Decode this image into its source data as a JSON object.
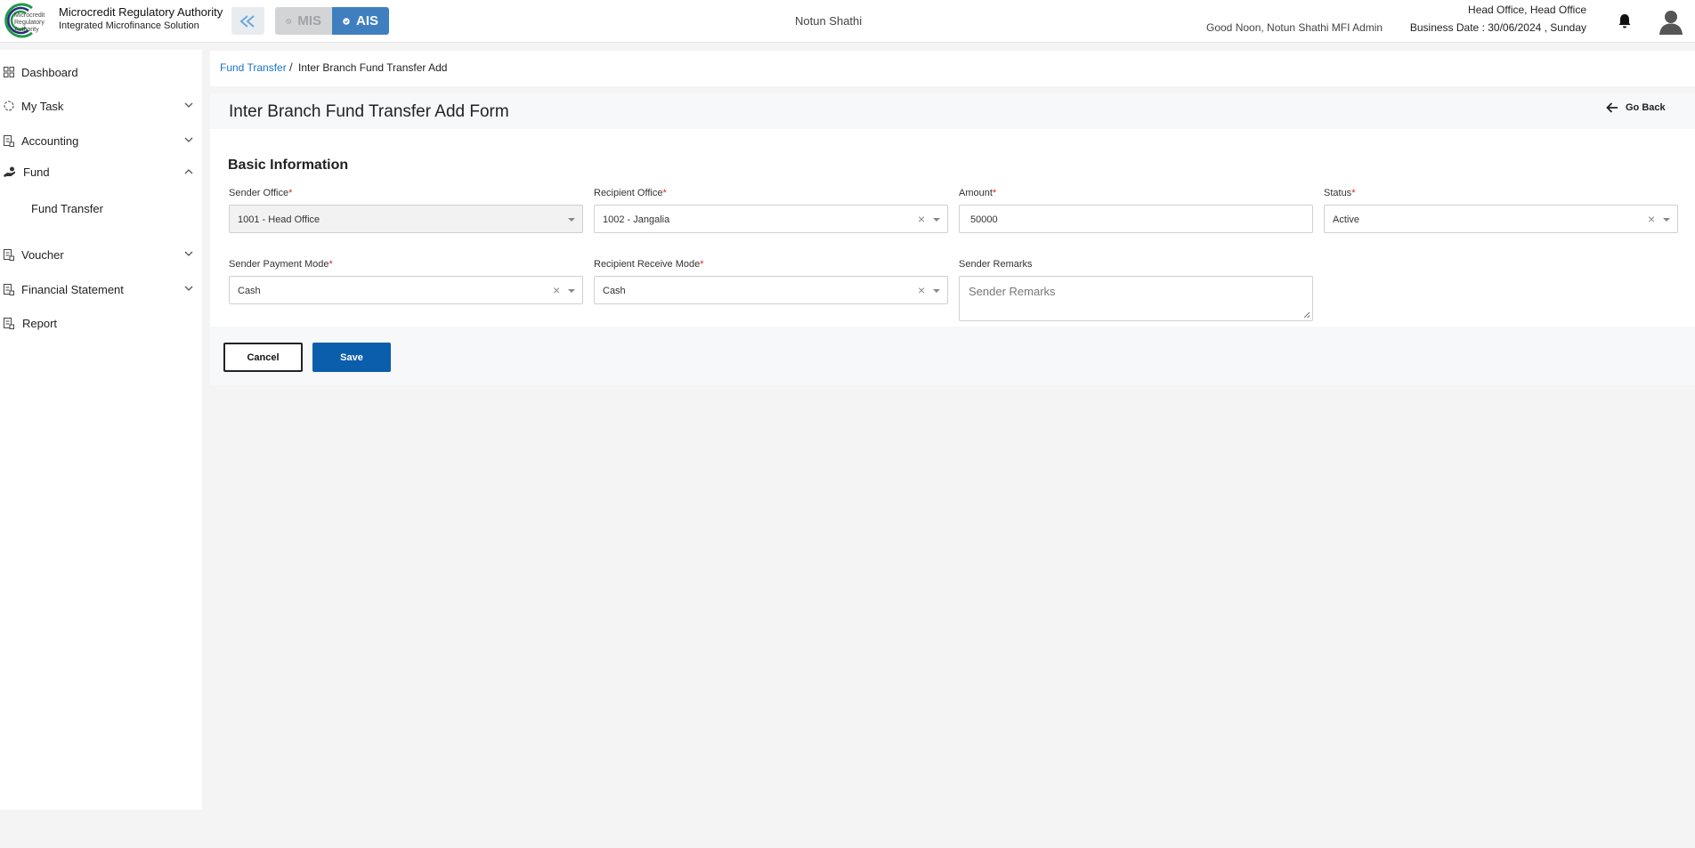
{
  "header": {
    "org_name": "Microcredit Regulatory Authority",
    "org_subtitle": "Integrated Microfinance Solution",
    "logo_text": [
      "Microcredit",
      "Regulatory",
      "Authority"
    ],
    "system_mis": "MIS",
    "system_ais": "AIS",
    "center_title": "Notun Shathi",
    "greeting": "Good Noon, Notun Shathi MFI Admin",
    "office": "Head Office, Head Office",
    "business_date": "Business Date : 30/06/2024 , Sunday",
    "colors": {
      "ais_active": "#3f7fbf",
      "mis_inactive": "#d2d4d6",
      "logo_green": "#1e9a4a"
    }
  },
  "sidebar": {
    "items": [
      {
        "label": "Dashboard",
        "icon": "grid-icon"
      },
      {
        "label": "My Task",
        "icon": "task-icon",
        "expandable": true
      },
      {
        "label": "Accounting",
        "icon": "ledger-icon",
        "expandable": true
      },
      {
        "label": "Fund",
        "icon": "hand-coin-icon",
        "expandable": true,
        "expanded": true
      },
      {
        "label": "Voucher",
        "icon": "ledger-icon",
        "expandable": true
      },
      {
        "label": "Financial Statement",
        "icon": "ledger-icon",
        "expandable": true
      },
      {
        "label": "Report",
        "icon": "ledger-icon"
      }
    ],
    "sub_items": {
      "fund": [
        "Fund Transfer"
      ]
    }
  },
  "breadcrumb": {
    "parent": "Fund Transfer",
    "separator": "/",
    "current": "Inter Branch Fund Transfer Add"
  },
  "form": {
    "title": "Inter Branch Fund Transfer Add Form",
    "go_back": "Go Back",
    "section": "Basic Information",
    "required_mark": "*",
    "fields": {
      "sender_office": {
        "label": "Sender Office",
        "value": "1001 - Head Office"
      },
      "recipient_office": {
        "label": "Recipient Office",
        "value": "1002 - Jangalia"
      },
      "amount": {
        "label": "Amount",
        "value": "50000"
      },
      "status": {
        "label": "Status",
        "value": "Active"
      },
      "sender_payment_mode": {
        "label": "Sender Payment Mode",
        "value": "Cash"
      },
      "recipient_receive_mode": {
        "label": "Recipient Receive Mode",
        "value": "Cash"
      },
      "sender_remarks": {
        "label": "Sender Remarks",
        "placeholder": "Sender Remarks"
      }
    },
    "clear_glyph": "×",
    "cancel_label": "Cancel",
    "save_label": "Save",
    "colors": {
      "save": "#0a5eab",
      "link": "#1a73c8",
      "required": "#d9262c"
    }
  }
}
